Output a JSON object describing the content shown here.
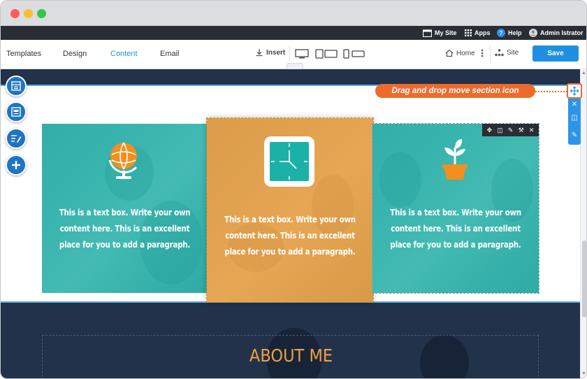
{
  "window": {
    "controls": [
      "close",
      "minimize",
      "zoom"
    ]
  },
  "topbar": {
    "my_site": "My Site",
    "apps": "Apps",
    "help": "Help",
    "user": "Admin Istrator"
  },
  "editbar": {
    "nav": [
      {
        "label": "Templates",
        "active": false
      },
      {
        "label": "Design",
        "active": false
      },
      {
        "label": "Content",
        "active": true
      },
      {
        "label": "Email",
        "active": false
      }
    ],
    "insert_label": "Insert",
    "devices": [
      "desktop-icon",
      "tablet-icon",
      "mobile-icon"
    ],
    "home_label": "Home",
    "site_label": "Site",
    "save_label": "Save"
  },
  "left_tools": [
    "layout-icon",
    "section-icon",
    "edit-text-icon",
    "add-icon"
  ],
  "callout": {
    "text": "Drag and drop move section icon"
  },
  "section_toolbar": [
    "move-icon",
    "delete-icon",
    "duplicate-icon",
    "edit-icon"
  ],
  "element_toolbar": [
    "move-icon",
    "copy-icon",
    "edit-icon",
    "settings-icon",
    "close-icon"
  ],
  "panels": [
    {
      "icon": "globe-icon",
      "text": "This is a text box. Write your own content here. This is an excellent place for you to add a paragraph."
    },
    {
      "icon": "clock-icon",
      "text": "This is a text box. Write your own content here. This is an excellent place for you to add a paragraph."
    },
    {
      "icon": "plant-icon",
      "text": "This is a text box. Write your own content here. This is an excellent place for you to add a paragraph."
    }
  ],
  "about": {
    "title": "ABOUT ME"
  },
  "colors": {
    "accent": "#1e8fe1",
    "callout": "#ef6a2d",
    "teal_overlay": "#23b4ac",
    "orange_overlay": "#eb9e3e",
    "about_title": "#f0a040",
    "dark_section": "#21324a"
  }
}
